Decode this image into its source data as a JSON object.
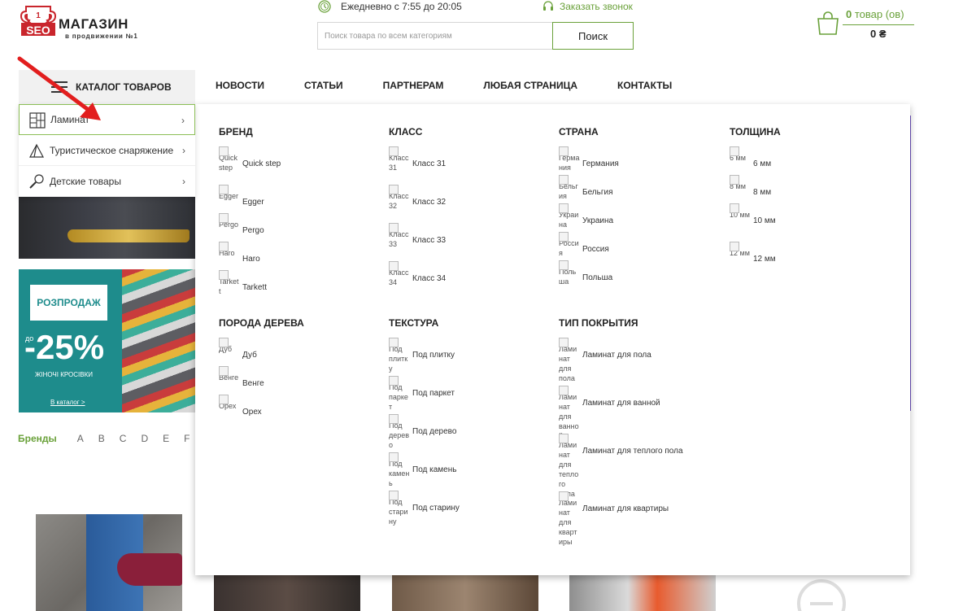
{
  "logo": {
    "badge_number": "1",
    "badge_text": "SEO",
    "title": "МАГАЗИН",
    "subtitle": "в продвижении №1"
  },
  "header": {
    "hours": "Ежедневно с 7:55 до 20:05",
    "callback": "Заказать звонок",
    "search_placeholder": "Поиск товара по всем категориям",
    "search_button": "Поиск",
    "cart_count": "0",
    "cart_count_suffix": "товар (ов)",
    "cart_sum": "0 ₴"
  },
  "nav": {
    "catalog_label": "КАТАЛОГ ТОВАРОВ",
    "items": [
      "НОВОСТИ",
      "СТАТЬИ",
      "ПАРТНЕРАМ",
      "ЛЮБАЯ СТРАНИЦА",
      "КОНТАКТЫ"
    ]
  },
  "side_menu": [
    {
      "label": "Ламинат",
      "icon": "parquet-icon",
      "active": true
    },
    {
      "label": "Туристическое снаряжение",
      "icon": "tent-icon",
      "active": false
    },
    {
      "label": "Детские товары",
      "icon": "rattle-icon",
      "active": false
    }
  ],
  "sale_banner": {
    "badge": "РОЗПРОДАЖ",
    "prefix": "до",
    "percent": "-25%",
    "subtitle": "ЖІНОЧІ КРОСІВКИ",
    "link": "В каталог >"
  },
  "brands": {
    "label": "Бренды",
    "letters": [
      "A",
      "B",
      "C",
      "D",
      "E",
      "F"
    ]
  },
  "mega_menu": {
    "brand": {
      "title": "БРЕНД",
      "items": [
        {
          "alt": "Quick step",
          "label": "Quick step"
        },
        {
          "alt": "Egger",
          "label": "Egger"
        },
        {
          "alt": "Pergo",
          "label": "Pergo"
        },
        {
          "alt": "Haro",
          "label": "Haro"
        },
        {
          "alt": "Tarkett",
          "label": "Tarkett"
        }
      ]
    },
    "class": {
      "title": "КЛАСС",
      "items": [
        {
          "alt": "Класс 31",
          "label": "Класс 31"
        },
        {
          "alt": "Класс 32",
          "label": "Класс 32"
        },
        {
          "alt": "Класс 33",
          "label": "Класс 33"
        },
        {
          "alt": "Класс 34",
          "label": "Класс 34"
        }
      ]
    },
    "country": {
      "title": "СТРАНА",
      "items": [
        {
          "alt": "Германия",
          "label": "Германия"
        },
        {
          "alt": "Бельгия",
          "label": "Бельгия"
        },
        {
          "alt": "Украина",
          "label": "Украина"
        },
        {
          "alt": "Россия",
          "label": "Россия"
        },
        {
          "alt": "Польша",
          "label": "Польша"
        }
      ]
    },
    "thickness": {
      "title": "ТОЛЩИНА",
      "items": [
        {
          "alt": "6 мм",
          "label": "6 мм"
        },
        {
          "alt": "8 мм",
          "label": "8 мм"
        },
        {
          "alt": "10 мм",
          "label": "10 мм"
        },
        {
          "alt": "12 мм",
          "label": "12 мм"
        }
      ]
    },
    "wood": {
      "title": "ПОРОДА ДЕРЕВА",
      "items": [
        {
          "alt": "Дуб",
          "label": "Дуб"
        },
        {
          "alt": "Венге",
          "label": "Венге"
        },
        {
          "alt": "Орех",
          "label": "Орех"
        }
      ]
    },
    "texture": {
      "title": "ТЕКСТУРА",
      "items": [
        {
          "alt": "Под плитку",
          "label": "Под плитку"
        },
        {
          "alt": "Под паркет",
          "label": "Под паркет"
        },
        {
          "alt": "Под дерево",
          "label": "Под дерево"
        },
        {
          "alt": "Под камень",
          "label": "Под камень"
        },
        {
          "alt": "Под старину",
          "label": "Под старину"
        }
      ]
    },
    "coating": {
      "title": "ТИП ПОКРЫТИЯ",
      "items": [
        {
          "alt": "Ламинат для пола",
          "label": "Ламинат для пола"
        },
        {
          "alt": "Ламинат для ванной",
          "label": "Ламинат для ванной"
        },
        {
          "alt": "Ламинат для теплого пола",
          "label": "Ламинат для теплого пола"
        },
        {
          "alt": "Ламинат для квартиры",
          "label": "Ламинат для квартиры"
        }
      ]
    }
  },
  "colors": {
    "accent_green": "#6aa13a",
    "sale_teal": "#1e8c8c",
    "arrow_red": "#e21e1e"
  }
}
